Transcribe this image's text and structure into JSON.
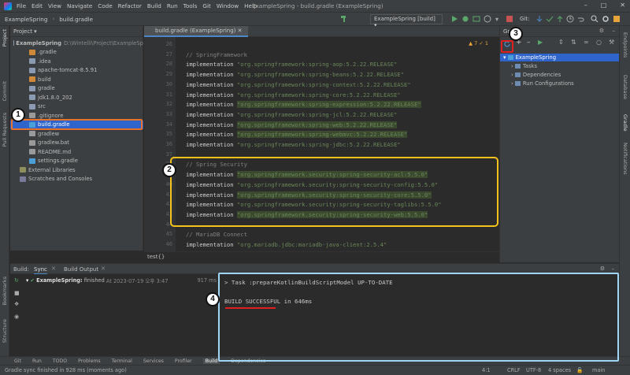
{
  "titlebar": {
    "menu": [
      "File",
      "Edit",
      "View",
      "Navigate",
      "Code",
      "Refactor",
      "Build",
      "Run",
      "Tools",
      "Git",
      "Window",
      "Help"
    ],
    "window_title": "ExampleSpring - build.gradle (ExampleSpring)"
  },
  "navbar": {
    "project": "ExampleSpring",
    "file": "build.gradle",
    "run_config": "ExampleSpring [build]",
    "git_label": "Git:"
  },
  "left_strip": {
    "project": "Project",
    "commit": "Commit",
    "pull_requests": "Pull Requests",
    "bookmarks": "Bookmarks",
    "structure": "Structure"
  },
  "right_strip": {
    "endpoints": "Endpoints",
    "database": "Database",
    "gradle": "Gradle",
    "notifications": "Notifications"
  },
  "project_panel": {
    "title": "Project",
    "rows": [
      {
        "label": "ExampleSpring",
        "suffix": "D:\\Wintelli\\Project\\ExampleSp",
        "indent": 4,
        "type": "folder"
      },
      {
        "label": ".gradle",
        "indent": 24,
        "type": "folder-orange"
      },
      {
        "label": ".idea",
        "indent": 24,
        "type": "folder"
      },
      {
        "label": "apache-tomcat-8.5.91",
        "indent": 24,
        "type": "folder"
      },
      {
        "label": "build",
        "indent": 24,
        "type": "folder-orange"
      },
      {
        "label": "gradle",
        "indent": 24,
        "type": "folder"
      },
      {
        "label": "jdk1.8.0_202",
        "indent": 24,
        "type": "folder"
      },
      {
        "label": "src",
        "indent": 24,
        "type": "folder"
      },
      {
        "label": ".gitignore",
        "indent": 24,
        "type": "file"
      },
      {
        "label": "build.gradle",
        "indent": 24,
        "type": "gradle",
        "selected": true
      },
      {
        "label": "gradlew",
        "indent": 24,
        "type": "file"
      },
      {
        "label": "gradlew.bat",
        "indent": 24,
        "type": "file"
      },
      {
        "label": "README.md",
        "indent": 24,
        "type": "file"
      },
      {
        "label": "settings.gradle",
        "indent": 24,
        "type": "gradle"
      },
      {
        "label": "External Libraries",
        "indent": 12,
        "type": "lib"
      },
      {
        "label": "Scratches and Consoles",
        "indent": 12,
        "type": "scratch"
      }
    ]
  },
  "editor": {
    "tab": "build.gradle (ExampleSpring)",
    "inspections": "▲ 7  ✓ 1",
    "lines": [
      {
        "n": "26",
        "parts": []
      },
      {
        "n": "27",
        "parts": [
          {
            "c": "cm",
            "t": "// SpringFramework"
          }
        ]
      },
      {
        "n": "28",
        "parts": [
          {
            "c": "kw",
            "t": "implementation "
          },
          {
            "c": "str",
            "t": "\"org.springframework:spring-aop:5.2.22.RELEASE\""
          }
        ]
      },
      {
        "n": "29",
        "parts": [
          {
            "c": "kw",
            "t": "implementation "
          },
          {
            "c": "str",
            "t": "\"org.springframework:spring-beans:5.2.22.RELEASE\""
          }
        ]
      },
      {
        "n": "30",
        "parts": [
          {
            "c": "kw",
            "t": "implementation "
          },
          {
            "c": "str",
            "t": "\"org.springframework:spring-context:5.2.22.RELEASE\""
          }
        ]
      },
      {
        "n": "31",
        "parts": [
          {
            "c": "kw",
            "t": "implementation "
          },
          {
            "c": "str",
            "t": "\"org.springframework:spring-core:5.2.22.RELEASE\""
          }
        ]
      },
      {
        "n": "32",
        "parts": [
          {
            "c": "kw",
            "t": "implementation "
          },
          {
            "c": "str hl",
            "t": "\"org.springframework:spring-expression:5.2.22.RELEASE\""
          }
        ]
      },
      {
        "n": "33",
        "parts": [
          {
            "c": "kw",
            "t": "implementation "
          },
          {
            "c": "str",
            "t": "\"org.springframework:spring-jcl:5.2.22.RELEASE\""
          }
        ]
      },
      {
        "n": "34",
        "parts": [
          {
            "c": "kw",
            "t": "implementation "
          },
          {
            "c": "str hl",
            "t": "\"org.springframework:spring-web:5.2.22.RELEASE\""
          }
        ]
      },
      {
        "n": "35",
        "parts": [
          {
            "c": "kw",
            "t": "implementation "
          },
          {
            "c": "str hl",
            "t": "\"org.springframework:spring-webmvc:5.2.22.RELEASE\""
          }
        ]
      },
      {
        "n": "36",
        "parts": [
          {
            "c": "kw",
            "t": "implementation "
          },
          {
            "c": "str",
            "t": "\"org.springframework:spring-jdbc:5.2.22.RELEASE\""
          }
        ]
      },
      {
        "n": "37",
        "parts": []
      },
      {
        "n": "38",
        "parts": [
          {
            "c": "cm",
            "t": "// Spring Security"
          }
        ]
      },
      {
        "n": "39",
        "parts": [
          {
            "c": "kw",
            "t": "implementation "
          },
          {
            "c": "str hl",
            "t": "\"org.springframework.security:spring-security-acl:5.5.0\""
          }
        ]
      },
      {
        "n": "40",
        "parts": [
          {
            "c": "kw",
            "t": "implementation "
          },
          {
            "c": "str",
            "t": "\"org.springframework.security:spring-security-config:5.5.0\""
          }
        ]
      },
      {
        "n": "41",
        "parts": [
          {
            "c": "kw",
            "t": "implementation "
          },
          {
            "c": "str hl",
            "t": "\"org.springframework.security:spring-security-core:5.5.0\""
          }
        ]
      },
      {
        "n": "42",
        "parts": [
          {
            "c": "kw",
            "t": "implementation "
          },
          {
            "c": "str",
            "t": "\"org.springframework.security:spring-security-taglibs:5.5.0\""
          }
        ]
      },
      {
        "n": "43",
        "parts": [
          {
            "c": "kw",
            "t": "implementation "
          },
          {
            "c": "str hl",
            "t": "\"org.springframework.security:spring-security-web:5.5.0\""
          }
        ]
      },
      {
        "n": "44",
        "parts": []
      },
      {
        "n": "45",
        "parts": [
          {
            "c": "cm",
            "t": "// MariaDB Connect"
          }
        ]
      },
      {
        "n": "46",
        "parts": [
          {
            "c": "kw",
            "t": "implementation "
          },
          {
            "c": "str",
            "t": "\"org.mariadb.jdbc:mariadb-java-client:2.5.4\""
          }
        ]
      }
    ],
    "breadcrumb": "test{}"
  },
  "gradle_panel": {
    "title": "Gradle",
    "root": "ExampleSpring",
    "children": [
      "Tasks",
      "Dependencies",
      "Run Configurations"
    ]
  },
  "build_panel": {
    "label": "Build:",
    "tab_sync": "Sync",
    "tab_output": "Build Output",
    "sync_item": "ExampleSpring:",
    "sync_status": "finished",
    "sync_time": "At 2023-07-19 오후 3:47",
    "sync_duration": "917 ms",
    "console_lines": [
      "> Task :prepareKotlinBuildScriptModel UP-TO-DATE",
      "",
      "BUILD SUCCESSFUL in 646ms"
    ]
  },
  "bottom_tabs": [
    "Git",
    "Run",
    "TODO",
    "Problems",
    "Terminal",
    "Services",
    "Profiler",
    "Build",
    "Dependencies"
  ],
  "status": {
    "message": "Gradle sync finished in 928 ms (moments ago)",
    "position": "4:1",
    "line_sep": "CRLF",
    "encoding": "UTF-8",
    "indent": "4 spaces",
    "branch": "main"
  },
  "annotations": [
    "1",
    "2",
    "3",
    "4"
  ],
  "colors": {
    "accent_selection": "#2f65ca",
    "highlight_box": "#f5c21b",
    "refresh_box": "#e02020",
    "underline": "#e02020"
  }
}
